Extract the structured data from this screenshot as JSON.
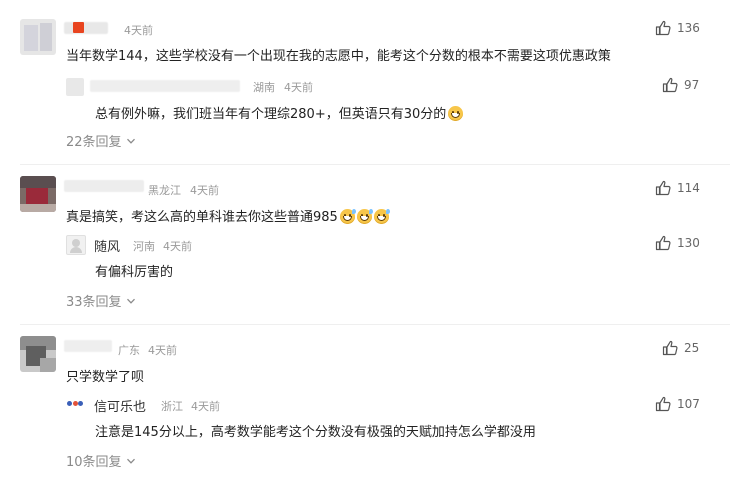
{
  "comments": [
    {
      "time": "4天前",
      "location": "",
      "text": "当年数学144，这些学校没有一个出现在我的志愿中，能考这个分数的根本不需要这项优惠政策",
      "likes": "136",
      "reply": {
        "name": "",
        "location": "湖南",
        "time": "4天前",
        "text": "总有例外嘛，我们班当年有个理综280+，但英语只有30分的",
        "likes": "97"
      },
      "more_replies": "22条回复"
    },
    {
      "time": "4天前",
      "location": "黑龙江",
      "text": "真是搞笑，考这么高的单科谁去你这些普通985",
      "likes": "114",
      "reply": {
        "name": "随风",
        "location": "河南",
        "time": "4天前",
        "text": "有偏科厉害的",
        "likes": "130"
      },
      "more_replies": "33条回复"
    },
    {
      "time": "4天前",
      "location": "广东",
      "text": "只学数学了呗",
      "likes": "25",
      "reply": {
        "name": "信可乐也",
        "location": "浙江",
        "time": "4天前",
        "text": "注意是145分以上，高考数学能考这个分数没有极强的天赋加持怎么学都没用",
        "likes": "107"
      },
      "more_replies": "10条回复"
    }
  ],
  "colors": {
    "text": "#222222",
    "meta": "#9a9a9a",
    "like": "#666666",
    "divider": "#efefef"
  }
}
